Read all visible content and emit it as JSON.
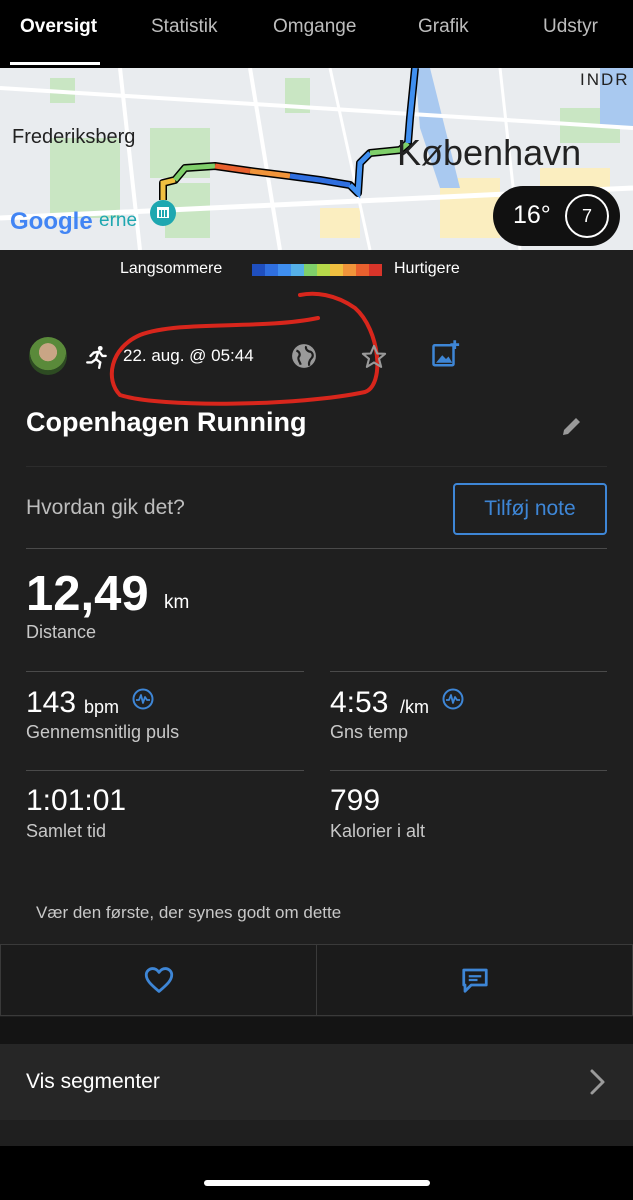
{
  "tabs": [
    "Oversigt",
    "Statistik",
    "Omgange",
    "Grafik",
    "Udstyr"
  ],
  "map": {
    "labels": {
      "frederiksberg": "Frederiksberg",
      "kobenhavn": "København",
      "indre": "INDR",
      "google": "Google",
      "erne": "erne"
    },
    "temperature": "16°",
    "moon_number": "7"
  },
  "legend": {
    "slower": "Langsommere",
    "faster": "Hurtigere",
    "colors": [
      "#1f4fbf",
      "#2f6fe0",
      "#3f8ff0",
      "#55b0e8",
      "#7fcf6a",
      "#b6d84a",
      "#f0c040",
      "#f0943a",
      "#e8602e",
      "#d8352a"
    ]
  },
  "activity": {
    "date": "22. aug. @ 05:44",
    "title": "Copenhagen Running",
    "note_prompt": "Hvordan gik det?",
    "note_button": "Tilføj note"
  },
  "stats": {
    "distance_value": "12,49",
    "distance_unit": "km",
    "distance_label": "Distance",
    "hr_value": "143",
    "hr_unit": "bpm",
    "hr_label": "Gennemsnitlig puls",
    "pace_value": "4:53",
    "pace_unit": "/km",
    "pace_label": "Gns temp",
    "time_value": "1:01:01",
    "time_label": "Samlet tid",
    "cal_value": "799",
    "cal_label": "Kalorier i alt"
  },
  "social": {
    "like_prompt": "Vær den første, der synes godt om dette"
  },
  "segments": {
    "label": "Vis segmenter"
  },
  "colors": {
    "accent": "#3e86d6",
    "annotation": "#d8261c"
  }
}
